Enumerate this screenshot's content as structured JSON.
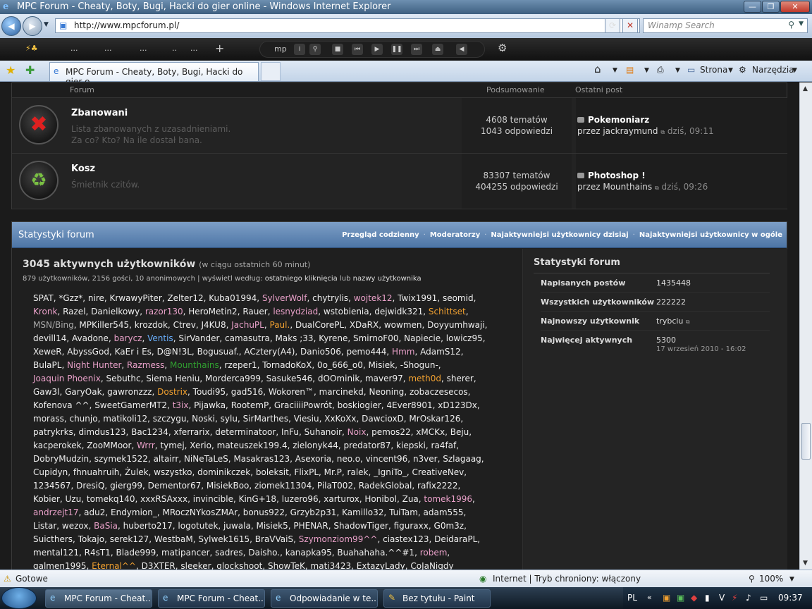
{
  "window": {
    "title": "MPC Forum - Cheaty, Boty, Bugi, Hacki do gier online - Windows Internet Explorer"
  },
  "address": {
    "url": "http://www.mpcforum.pl/",
    "search_placeholder": "Winamp Search"
  },
  "toolbar2": {
    "items": [
      "...",
      "...",
      "...",
      "..",
      "..."
    ],
    "media_label": "mp"
  },
  "tabbar": {
    "tab_title": "MPC Forum - Cheaty, Boty, Bugi, Hacki do gier o...",
    "strona": "Strona",
    "narzedzia": "Narzędzia"
  },
  "forum_header": {
    "forum": "Forum",
    "summary": "Podsumowanie",
    "last_post": "Ostatni post"
  },
  "forums": [
    {
      "title": "Zbanowani",
      "desc1": "Lista zbanowanych z uzasadnieniami.",
      "desc2": "Za co? Kto? Na ile dostał bana.",
      "topics": "4608 tematów",
      "replies": "1043 odpowiedzi",
      "last_title": "Pokemoniarz",
      "last_by": "przez jackraymund",
      "last_time": "dziś, 09:11"
    },
    {
      "title": "Kosz",
      "desc1": "Śmietnik czitów.",
      "desc2": "",
      "topics": "83307 tematów",
      "replies": "404255 odpowiedzi",
      "last_title": "Photoshop !",
      "last_by": "przez Mounthains",
      "last_time": "dziś, 09:26"
    }
  ],
  "stats": {
    "header": "Statystyki forum",
    "links": [
      "Przegląd codzienny",
      "Moderatorzy",
      "Najaktywniejsi użytkownicy dzisiaj",
      "Najaktywniejsi użytkownicy w ogóle"
    ],
    "active_title": "3045 aktywnych użytkowników",
    "active_sub": "(w ciągu ostatnich 60 minut)",
    "active_line": "879 użytkowników, 2156 gości, 10 anonimowych | wyświetl według:",
    "sort1": "ostatniego kliknięcia",
    "sort_or": "lub",
    "sort2": "nazwy użytkownika",
    "users": [
      [
        "SPAT",
        "#eeeeee"
      ],
      [
        "*Gzz*",
        "#eeeeee"
      ],
      [
        "nire",
        "#eeeeee"
      ],
      [
        "KrwawyPiter",
        "#eeeeee"
      ],
      [
        "Zelter12",
        "#eeeeee"
      ],
      [
        "Kuba01994",
        "#eeeeee"
      ],
      [
        "SylverWolf",
        "#e8a0c8"
      ],
      [
        "chytrylis",
        "#eeeeee"
      ],
      [
        "wojtek12",
        "#e8a0c8"
      ],
      [
        "Twix1991",
        "#eeeeee"
      ],
      [
        "seomid",
        "#eeeeee"
      ],
      [
        "Kronk",
        "#e8a0c8"
      ],
      [
        "Razel",
        "#eeeeee"
      ],
      [
        "Danielkowy",
        "#eeeeee"
      ],
      [
        "razor130",
        "#e8a0c8"
      ],
      [
        "HeroMetin2",
        "#eeeeee"
      ],
      [
        "Rauer",
        "#eeeeee"
      ],
      [
        "lesnydziad",
        "#e8a0c8"
      ],
      [
        "wstobienia",
        "#eeeeee"
      ],
      [
        "dejwidk321",
        "#eeeeee"
      ],
      [
        "Schittset",
        "#f0a030"
      ],
      [
        "MSN/Bing",
        "#aaaaaa"
      ],
      [
        "MPKiller545",
        "#eeeeee"
      ],
      [
        "krozdok",
        "#eeeeee"
      ],
      [
        "Ctrev",
        "#eeeeee"
      ],
      [
        "J4KU8",
        "#eeeeee"
      ],
      [
        "JachuPL",
        "#e8a0c8"
      ],
      [
        "Paul.",
        "#f0a030"
      ],
      [
        "DualCorePL",
        "#eeeeee"
      ],
      [
        "XDaRX",
        "#eeeeee"
      ],
      [
        "wowmen",
        "#eeeeee"
      ],
      [
        "Doyyumhwaji",
        "#eeeeee"
      ],
      [
        "devill14",
        "#eeeeee"
      ],
      [
        "Avadone",
        "#eeeeee"
      ],
      [
        "barycz",
        "#e8a0c8"
      ],
      [
        "Ventis",
        "#6ab0ff"
      ],
      [
        "SirVander",
        "#eeeeee"
      ],
      [
        "camasutra",
        "#eeeeee"
      ],
      [
        "Maks ;33",
        "#eeeeee"
      ],
      [
        "Kyrene",
        "#eeeeee"
      ],
      [
        "SmirnoF00",
        "#eeeeee"
      ],
      [
        "Napiecie",
        "#eeeeee"
      ],
      [
        "lowicz95",
        "#eeeeee"
      ],
      [
        "XeweR",
        "#eeeeee"
      ],
      [
        "AbyssGod",
        "#eeeeee"
      ],
      [
        "KaEr i Es",
        "#eeeeee"
      ],
      [
        "D@N!3L",
        "#eeeeee"
      ],
      [
        "Bogusuaf.",
        "#eeeeee"
      ],
      [
        "ACztery(A4)",
        "#eeeeee"
      ],
      [
        "Danio506",
        "#eeeeee"
      ],
      [
        "pemo444",
        "#eeeeee"
      ],
      [
        "Hmm",
        "#e8a0c8"
      ],
      [
        "AdamS12",
        "#eeeeee"
      ],
      [
        "BulaPL",
        "#eeeeee"
      ],
      [
        "Night Hunter",
        "#e8a0c8"
      ],
      [
        "Razmess",
        "#e8a0c8"
      ],
      [
        "Mounthains",
        "#30a030"
      ],
      [
        "rzeper1",
        "#eeeeee"
      ],
      [
        "TornadoKoX",
        "#eeeeee"
      ],
      [
        "0o_666_o0",
        "#eeeeee"
      ],
      [
        "Misiek",
        "#eeeeee"
      ],
      [
        "-Shogun-",
        "#eeeeee"
      ],
      [
        "Joaquin Phoenix",
        "#e8a0c8"
      ],
      [
        "Sebuthc",
        "#eeeeee"
      ],
      [
        "Siema Heniu",
        "#eeeeee"
      ],
      [
        "Morderca999",
        "#eeeeee"
      ],
      [
        "Sasuke546",
        "#eeeeee"
      ],
      [
        "dOOminik",
        "#eeeeee"
      ],
      [
        "maver97",
        "#eeeeee"
      ],
      [
        "meth0d",
        "#f0a030"
      ],
      [
        "sherer",
        "#eeeeee"
      ],
      [
        "Gaw3l",
        "#eeeeee"
      ],
      [
        "GaryOak",
        "#eeeeee"
      ],
      [
        "gawronzzz",
        "#eeeeee"
      ],
      [
        "Dostrix",
        "#f0a030"
      ],
      [
        "Toudi95",
        "#eeeeee"
      ],
      [
        "gad516",
        "#eeeeee"
      ],
      [
        "Wokoren™",
        "#eeeeee"
      ],
      [
        "marcinekd",
        "#eeeeee"
      ],
      [
        "Neoning",
        "#eeeeee"
      ],
      [
        "zobaczesecos",
        "#eeeeee"
      ],
      [
        "Kofenova ^^",
        "#eeeeee"
      ],
      [
        "SweetGamerMT2",
        "#eeeeee"
      ],
      [
        "t3ix",
        "#e8a0c8"
      ],
      [
        "Pijawka",
        "#eeeeee"
      ],
      [
        "RootemP",
        "#eeeeee"
      ],
      [
        "GraciiiiPowrót",
        "#eeeeee"
      ],
      [
        "boskiogier",
        "#eeeeee"
      ],
      [
        "4Ever8901",
        "#eeeeee"
      ],
      [
        "xD123Dx",
        "#eeeeee"
      ],
      [
        "morass",
        "#eeeeee"
      ],
      [
        "chunjo",
        "#eeeeee"
      ],
      [
        "matikoli12",
        "#eeeeee"
      ],
      [
        "szczygu",
        "#eeeeee"
      ],
      [
        "Noski",
        "#eeeeee"
      ],
      [
        "sylu",
        "#eeeeee"
      ],
      [
        "SirMarthes",
        "#eeeeee"
      ],
      [
        "Viesiu",
        "#eeeeee"
      ],
      [
        "XxKoXx",
        "#eeeeee"
      ],
      [
        "DawcioxD",
        "#eeeeee"
      ],
      [
        "MrOskar126",
        "#eeeeee"
      ],
      [
        "patrykrks",
        "#eeeeee"
      ],
      [
        "dimdus123",
        "#eeeeee"
      ],
      [
        "Bac1234",
        "#eeeeee"
      ],
      [
        "xferrarix",
        "#eeeeee"
      ],
      [
        "determinatoor",
        "#eeeeee"
      ],
      [
        "InFu",
        "#eeeeee"
      ],
      [
        "Suhanoir",
        "#eeeeee"
      ],
      [
        "Noix",
        "#e8a0c8"
      ],
      [
        "pemos22",
        "#eeeeee"
      ],
      [
        "xMCKx",
        "#eeeeee"
      ],
      [
        "Beju",
        "#eeeeee"
      ],
      [
        "kacperokek",
        "#eeeeee"
      ],
      [
        "ZooMMoor",
        "#eeeeee"
      ],
      [
        "Wrrr",
        "#e8a0c8"
      ],
      [
        "tymej",
        "#eeeeee"
      ],
      [
        "Xerio",
        "#eeeeee"
      ],
      [
        "mateuszek199.4",
        "#eeeeee"
      ],
      [
        "zielonyk44",
        "#eeeeee"
      ],
      [
        "predator87",
        "#eeeeee"
      ],
      [
        "kiepski",
        "#eeeeee"
      ],
      [
        "ra4faf",
        "#eeeeee"
      ],
      [
        "DobryMudzin",
        "#eeeeee"
      ],
      [
        "szymek1522",
        "#eeeeee"
      ],
      [
        "altairr",
        "#eeeeee"
      ],
      [
        "NiNeTaLeS",
        "#eeeeee"
      ],
      [
        "Masakras123",
        "#eeeeee"
      ],
      [
        "Asexoria",
        "#eeeeee"
      ],
      [
        "neo.o",
        "#eeeeee"
      ],
      [
        "vincent96",
        "#eeeeee"
      ],
      [
        "n3ver",
        "#eeeeee"
      ],
      [
        "Szlagaag",
        "#eeeeee"
      ],
      [
        "Cupidyn",
        "#eeeeee"
      ],
      [
        "fhnuahruih",
        "#eeeeee"
      ],
      [
        "Żulek",
        "#eeeeee"
      ],
      [
        "wszystko",
        "#eeeeee"
      ],
      [
        "dominikczek",
        "#eeeeee"
      ],
      [
        "boleksit",
        "#eeeeee"
      ],
      [
        "FlixPL",
        "#eeeeee"
      ],
      [
        "Mr.P",
        "#eeeeee"
      ],
      [
        "ralek",
        "#eeeeee"
      ],
      [
        "_IgniTo_",
        "#eeeeee"
      ],
      [
        "CreativeNev",
        "#eeeeee"
      ],
      [
        "1234567",
        "#eeeeee"
      ],
      [
        "DresiQ",
        "#eeeeee"
      ],
      [
        "gierg99",
        "#eeeeee"
      ],
      [
        "Dementor67",
        "#eeeeee"
      ],
      [
        "MisiekBoo",
        "#eeeeee"
      ],
      [
        "ziomek11304",
        "#eeeeee"
      ],
      [
        "PilaT002",
        "#eeeeee"
      ],
      [
        "RadekGlobal",
        "#eeeeee"
      ],
      [
        "rafix2222",
        "#eeeeee"
      ],
      [
        "Kobier",
        "#eeeeee"
      ],
      [
        "Uzu",
        "#eeeeee"
      ],
      [
        "tomekq140",
        "#eeeeee"
      ],
      [
        "xxxRSAxxx",
        "#eeeeee"
      ],
      [
        "invincible",
        "#eeeeee"
      ],
      [
        "KinG+18",
        "#eeeeee"
      ],
      [
        "luzero96",
        "#eeeeee"
      ],
      [
        "xarturox",
        "#eeeeee"
      ],
      [
        "Honibol",
        "#eeeeee"
      ],
      [
        "Zua",
        "#eeeeee"
      ],
      [
        "tomek1996",
        "#e8a0c8"
      ],
      [
        "andrzejt17",
        "#e8a0c8"
      ],
      [
        "adu2",
        "#eeeeee"
      ],
      [
        "Endymion_",
        "#eeeeee"
      ],
      [
        "MRoczNYkosZMAr",
        "#eeeeee"
      ],
      [
        "bonus922",
        "#eeeeee"
      ],
      [
        "Grzyb2p31",
        "#eeeeee"
      ],
      [
        "Kamillo32",
        "#eeeeee"
      ],
      [
        "TuiTam",
        "#eeeeee"
      ],
      [
        "adam555",
        "#eeeeee"
      ],
      [
        "Listar",
        "#eeeeee"
      ],
      [
        "wezox",
        "#eeeeee"
      ],
      [
        "BaSia",
        "#e8a0c8"
      ],
      [
        "huberto217",
        "#eeeeee"
      ],
      [
        "logotutek",
        "#eeeeee"
      ],
      [
        "juwala",
        "#eeeeee"
      ],
      [
        "Misiek5",
        "#eeeeee"
      ],
      [
        "PHENAR",
        "#eeeeee"
      ],
      [
        "ShadowTiger",
        "#eeeeee"
      ],
      [
        "figuraxx",
        "#eeeeee"
      ],
      [
        "G0m3z",
        "#eeeeee"
      ],
      [
        "Suicthers",
        "#eeeeee"
      ],
      [
        "Tokajo",
        "#eeeeee"
      ],
      [
        "serek127",
        "#eeeeee"
      ],
      [
        "WestbaM",
        "#eeeeee"
      ],
      [
        "Sylwek1615",
        "#eeeeee"
      ],
      [
        "BraVVaiS",
        "#eeeeee"
      ],
      [
        "Szymonziom99^^",
        "#e8a0c8"
      ],
      [
        "ciastex123",
        "#eeeeee"
      ],
      [
        "DeidaraPL",
        "#eeeeee"
      ],
      [
        "mental121",
        "#eeeeee"
      ],
      [
        "R4sT1",
        "#eeeeee"
      ],
      [
        "Blade999",
        "#eeeeee"
      ],
      [
        "matipancer",
        "#eeeeee"
      ],
      [
        "sadres",
        "#eeeeee"
      ],
      [
        "Daisho.",
        "#eeeeee"
      ],
      [
        "kanapka95",
        "#eeeeee"
      ],
      [
        "Buahahaha.^^#1",
        "#eeeeee"
      ],
      [
        "robem",
        "#e8a0c8"
      ],
      [
        "galmen1995",
        "#eeeeee"
      ],
      [
        "Eternal^^",
        "#f0a030"
      ],
      [
        "D3XTER",
        "#eeeeee"
      ],
      [
        "sleeker",
        "#eeeeee"
      ],
      [
        "glockshoot",
        "#eeeeee"
      ],
      [
        "ShowTeK",
        "#eeeeee"
      ],
      [
        "mati3423",
        "#eeeeee"
      ],
      [
        "ExtazyLady",
        "#eeeeee"
      ],
      [
        "CoJaNigdy",
        "#eeeeee"
      ]
    ],
    "right_title": "Statystyki forum",
    "rows": [
      {
        "k": "Napisanych postów",
        "v": "1435448",
        "v2": ""
      },
      {
        "k": "Wszystkich użytkowników",
        "v": "222222",
        "v2": ""
      },
      {
        "k": "Najnowszy użytkownik",
        "v": "trybciu",
        "v2": ""
      },
      {
        "k": "Najwięcej aktywnych",
        "v": "5300",
        "v2": "17 wrzesień 2010 - 16:02"
      }
    ]
  },
  "statusbar": {
    "left": "Gotowe",
    "zone": "Internet | Tryb chroniony: włączony",
    "zoom": "100%"
  },
  "taskbar": {
    "buttons": [
      "MPC Forum - Cheat...",
      "MPC Forum - Cheat...",
      "Odpowiadanie w te...",
      "Bez tytułu - Paint"
    ],
    "lang": "PL",
    "clock": "09:37"
  }
}
